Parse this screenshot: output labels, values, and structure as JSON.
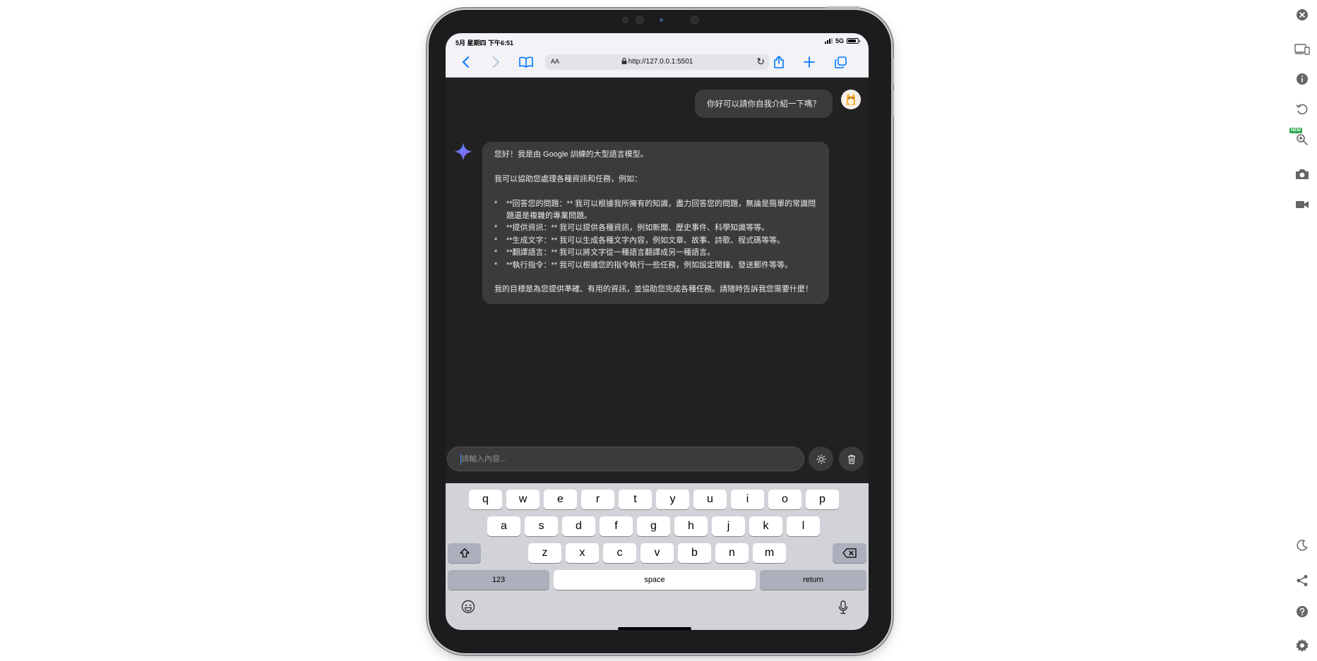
{
  "status_bar": {
    "time": "5月 星期四 下午6:51",
    "network": "5G"
  },
  "browser": {
    "text_size": "AA",
    "url": "http://127.0.0.1:5501"
  },
  "chat": {
    "user_message": "你好可以請你自我介紹一下嗎？",
    "bot_intro": "您好！我是由 Google 訓練的大型語言模型。",
    "bot_help": "我可以協助您處理各種資訊和任務，例如：",
    "bot_items": [
      "**回答您的問題：** 我可以根據我所擁有的知識，盡力回答您的問題，無論是簡單的常識問題還是複雜的專業問題。",
      "**提供資訊：** 我可以提供各種資訊，例如新聞、歷史事件、科學知識等等。",
      "**生成文字：** 我可以生成各種文字內容，例如文章、故事、詩歌、程式碼等等。",
      "**翻譯語言：** 我可以將文字從一種語言翻譯成另一種語言。",
      "**執行指令：** 我可以根據您的指令執行一些任務，例如設定鬧鐘、發送郵件等等。"
    ],
    "bot_outro": "我的目標是為您提供準確、有用的資訊，並協助您完成各種任務。請隨時告訴我您需要什麼！"
  },
  "input": {
    "placeholder": "請輸入內容..."
  },
  "keyboard": {
    "row1": [
      "q",
      "w",
      "e",
      "r",
      "t",
      "y",
      "u",
      "i",
      "o",
      "p"
    ],
    "row2": [
      "a",
      "s",
      "d",
      "f",
      "g",
      "h",
      "j",
      "k",
      "l"
    ],
    "row3": [
      "z",
      "x",
      "c",
      "v",
      "b",
      "n",
      "m"
    ],
    "numbers_label": "123",
    "space_label": "space",
    "return_label": "return"
  },
  "toolbar": {
    "new_badge": "NEW"
  },
  "colors": {
    "accent": "#007aff",
    "chat_bg": "#212121",
    "bubble": "#3b3b3b"
  }
}
